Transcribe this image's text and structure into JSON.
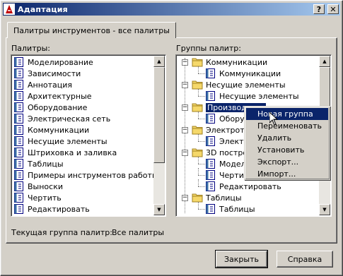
{
  "window": {
    "title": "Адаптация"
  },
  "tabs": [
    {
      "label": "Палитры инструментов - все палитры"
    }
  ],
  "palettes": {
    "label": "Палитры:",
    "items": [
      "Моделирование",
      "Зависимости",
      "Аннотация",
      "Архитектурные",
      "Оборудование",
      "Электрическая сеть",
      "Коммуникации",
      "Несущие элементы",
      "Штриховка и заливка",
      "Таблицы",
      "Примеры инструментов работы с",
      "Выноски",
      "Чертить",
      "Редактировать"
    ]
  },
  "groups": {
    "label": "Группы палитр:",
    "tree": [
      {
        "text": "Коммуникации",
        "level": 0
      },
      {
        "text": "Коммуникации",
        "level": 1
      },
      {
        "text": "Несущие элементы",
        "level": 0
      },
      {
        "text": "Несущие элементы",
        "level": 1
      },
      {
        "text": "Производство",
        "level": 0,
        "selected": true
      },
      {
        "text": "Оборудование",
        "level": 1
      },
      {
        "text": "Электротехника",
        "level": 0
      },
      {
        "text": "Электрическая сеть",
        "level": 1
      },
      {
        "text": "3D построение",
        "level": 0
      },
      {
        "text": "Моделирование",
        "level": 1
      },
      {
        "text": "Чертить",
        "level": 1
      },
      {
        "text": "Редактировать",
        "level": 1
      },
      {
        "text": "Таблицы",
        "level": 0
      },
      {
        "text": "Таблицы",
        "level": 1
      }
    ]
  },
  "context_menu": {
    "items": [
      {
        "label": "Новая группа",
        "highlighted": true
      },
      {
        "label": "Переименовать"
      },
      {
        "label": "Удалить"
      },
      {
        "label": "Установить"
      },
      {
        "label": "Экспорт..."
      },
      {
        "label": "Импорт..."
      }
    ]
  },
  "status": {
    "current_group_label": "Текущая группа палитр:",
    "current_group_value": "Все палитры"
  },
  "buttons": {
    "close": "Закрыть",
    "help": "Справка"
  }
}
